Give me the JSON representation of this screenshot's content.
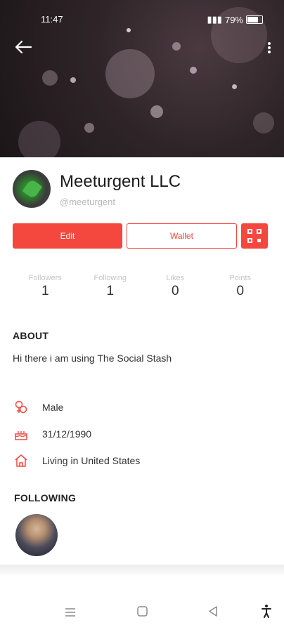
{
  "status": {
    "time": "11:47",
    "battery": "79%"
  },
  "header": {
    "back_icon": "arrow-left-icon",
    "menu_icon": "more-vertical-icon"
  },
  "profile": {
    "name": "Meeturgent LLC",
    "handle": "@meeturgent"
  },
  "actions": {
    "edit": "Edit",
    "wallet": "Wallet",
    "qr_icon": "qr-code-icon"
  },
  "stats": [
    {
      "label": "Followers",
      "value": "1"
    },
    {
      "label": "Following",
      "value": "1"
    },
    {
      "label": "Likes",
      "value": "0"
    },
    {
      "label": "Points",
      "value": "0"
    }
  ],
  "about": {
    "title": "ABOUT",
    "text": "Hi there i am using The Social Stash"
  },
  "info": [
    {
      "icon": "gender-icon",
      "text": "Male"
    },
    {
      "icon": "birthday-cake-icon",
      "text": "31/12/1990"
    },
    {
      "icon": "home-icon",
      "text": "Living in United States"
    }
  ],
  "following": {
    "title": "FOLLOWING"
  },
  "colors": {
    "accent": "#f4473e"
  }
}
